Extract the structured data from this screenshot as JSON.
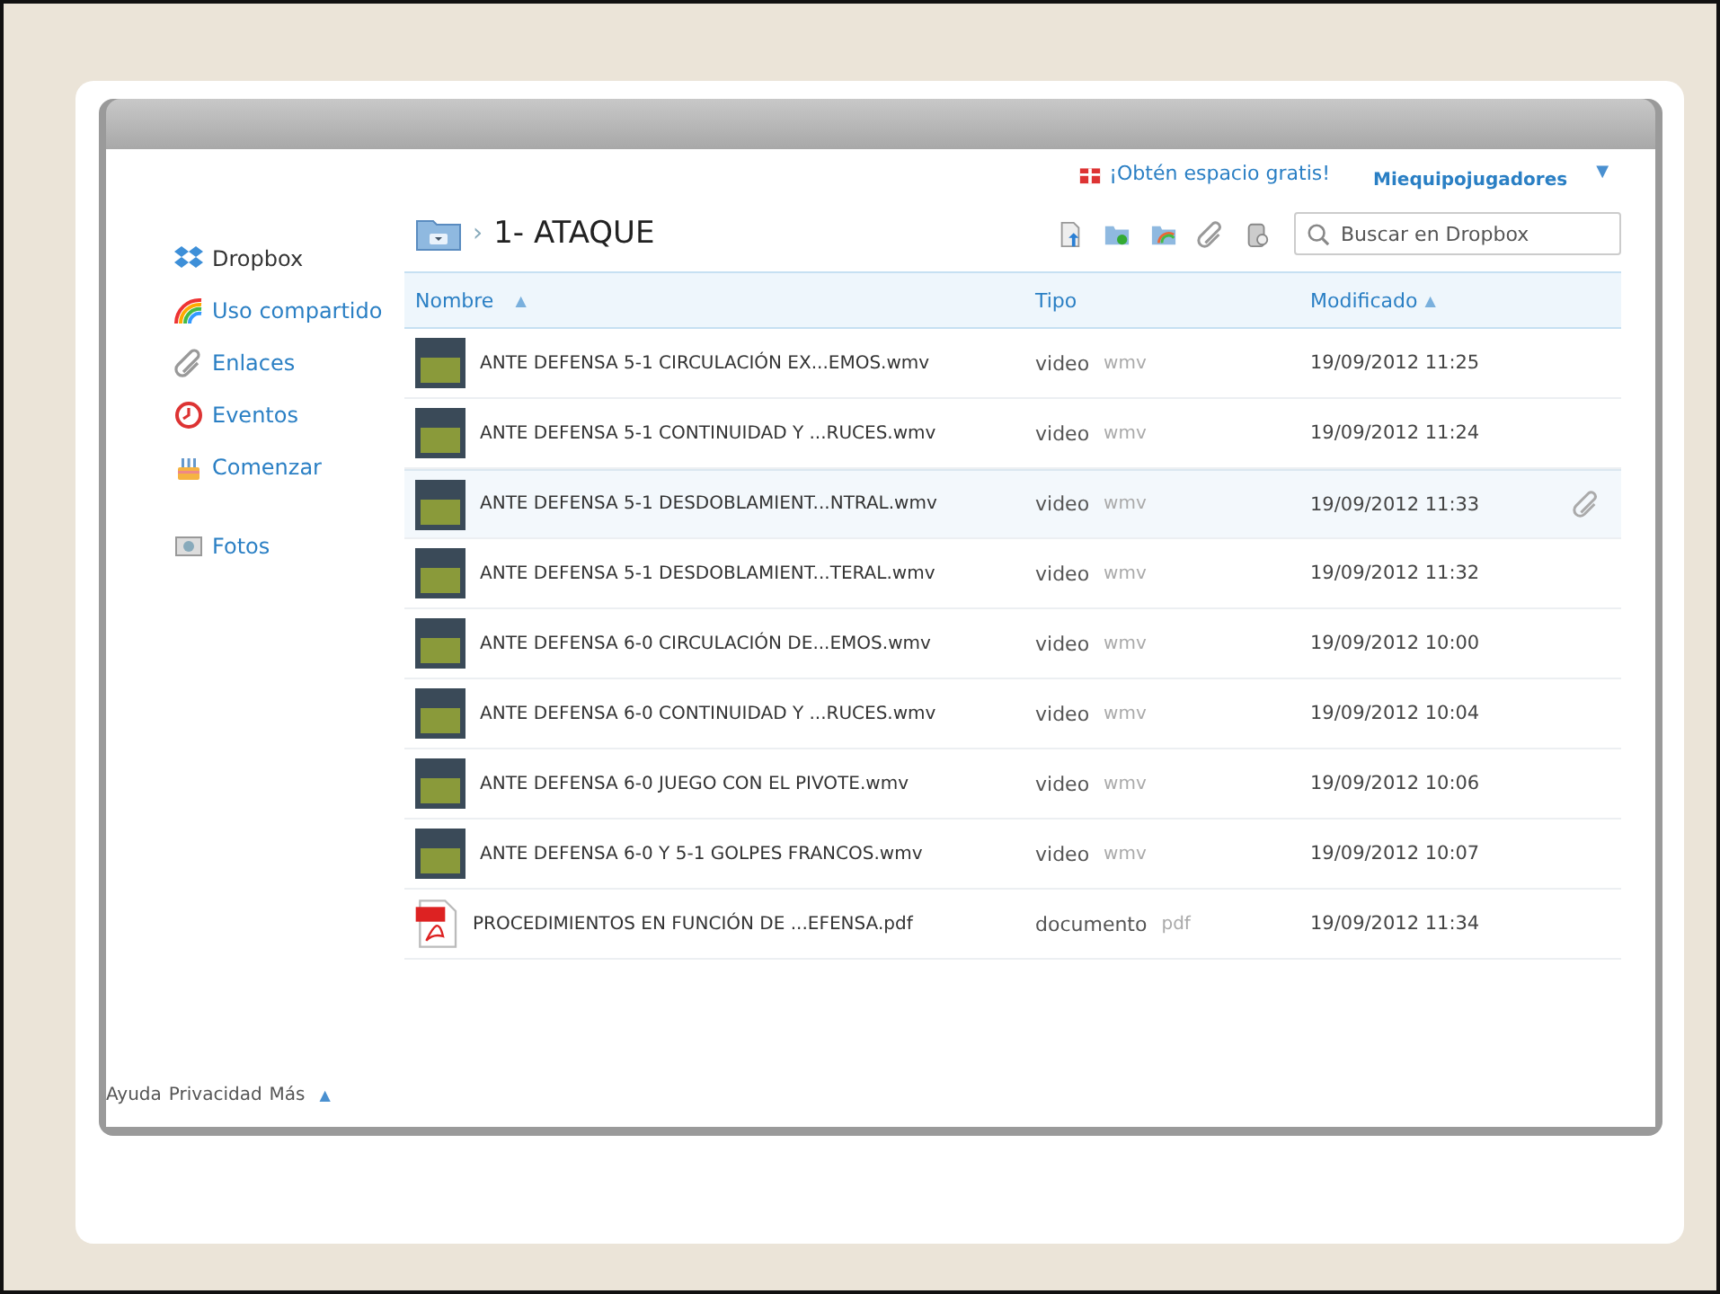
{
  "header": {
    "promo": "¡Obtén espacio gratis!",
    "account": "Miequipojugadores",
    "account_caret": "▼"
  },
  "sidebar": {
    "items": [
      {
        "label": "Dropbox",
        "kind": "dropbox"
      },
      {
        "label": "Uso compartido",
        "kind": "rainbow"
      },
      {
        "label": "Enlaces",
        "kind": "link"
      },
      {
        "label": "Eventos",
        "kind": "clock"
      },
      {
        "label": "Comenzar",
        "kind": "cake"
      },
      {
        "label": "Fotos",
        "kind": "photo"
      }
    ]
  },
  "breadcrumb": {
    "separator": "›",
    "folder": "1- ATAQUE"
  },
  "search": {
    "placeholder": "Buscar en Dropbox"
  },
  "table": {
    "columns": [
      {
        "label": "Nombre",
        "sort": "▲"
      },
      {
        "label": "Tipo"
      },
      {
        "label": "Modificado",
        "sort": "▲"
      }
    ],
    "rows": [
      {
        "name": "ANTE DEFENSA 5-1 CIRCULACIÓN EX...EMOS.wmv",
        "kind": "video",
        "type": "video",
        "ext": "wmv",
        "modified": "19/09/2012 11:25",
        "selected": false
      },
      {
        "name": "ANTE DEFENSA 5-1 CONTINUIDAD Y ...RUCES.wmv",
        "kind": "video",
        "type": "video",
        "ext": "wmv",
        "modified": "19/09/2012 11:24",
        "selected": false
      },
      {
        "name": "ANTE DEFENSA 5-1 DESDOBLAMIENT...NTRAL.wmv",
        "kind": "video",
        "type": "video",
        "ext": "wmv",
        "modified": "19/09/2012 11:33",
        "selected": true
      },
      {
        "name": "ANTE DEFENSA 5-1 DESDOBLAMIENT...TERAL.wmv",
        "kind": "video",
        "type": "video",
        "ext": "wmv",
        "modified": "19/09/2012 11:32",
        "selected": false
      },
      {
        "name": "ANTE DEFENSA 6-0 CIRCULACIÓN DE...EMOS.wmv",
        "kind": "video",
        "type": "video",
        "ext": "wmv",
        "modified": "19/09/2012 10:00",
        "selected": false
      },
      {
        "name": "ANTE DEFENSA 6-0 CONTINUIDAD Y ...RUCES.wmv",
        "kind": "video",
        "type": "video",
        "ext": "wmv",
        "modified": "19/09/2012 10:04",
        "selected": false
      },
      {
        "name": "ANTE DEFENSA 6-0 JUEGO CON EL PIVOTE.wmv",
        "kind": "video",
        "type": "video",
        "ext": "wmv",
        "modified": "19/09/2012 10:06",
        "selected": false
      },
      {
        "name": "ANTE DEFENSA 6-0 Y 5-1 GOLPES FRANCOS.wmv",
        "kind": "video",
        "type": "video",
        "ext": "wmv",
        "modified": "19/09/2012 10:07",
        "selected": false
      },
      {
        "name": "PROCEDIMIENTOS EN FUNCIÓN DE ...EFENSA.pdf",
        "kind": "pdf",
        "type": "documento",
        "ext": "pdf",
        "modified": "19/09/2012 11:34",
        "selected": false
      }
    ]
  },
  "footer": {
    "links": [
      "Ayuda",
      "Privacidad",
      "Más"
    ],
    "caret": "▲"
  }
}
